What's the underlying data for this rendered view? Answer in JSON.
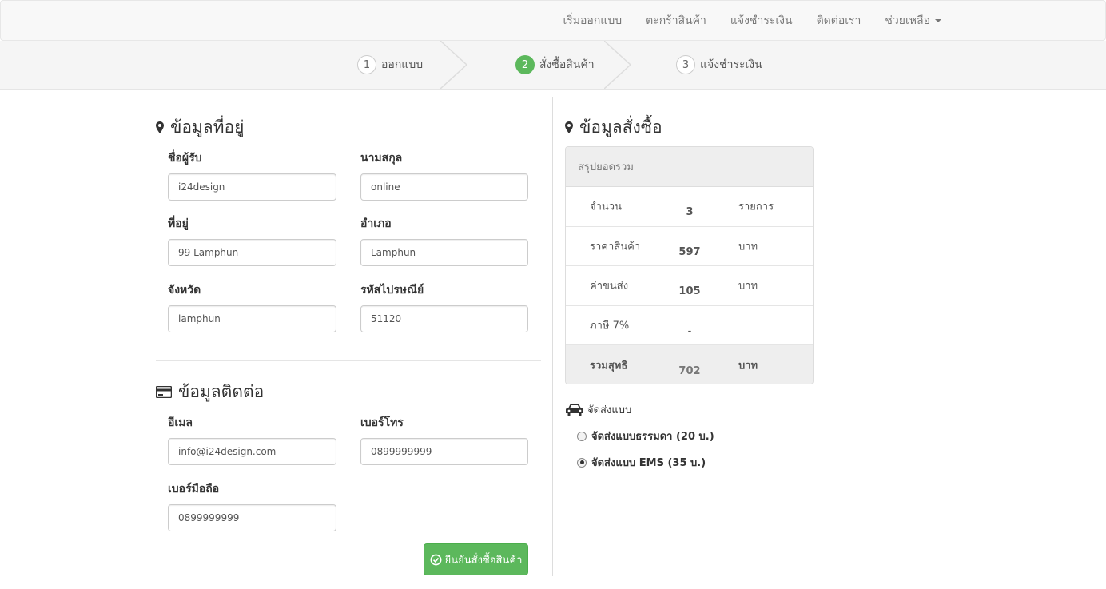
{
  "nav": {
    "items": [
      "เริ่มออกแบบ",
      "ตะกร้าสินค้า",
      "แจ้งชำระเงิน",
      "ติดต่อเรา",
      "ช่วยเหลือ"
    ]
  },
  "steps": [
    {
      "num": "1",
      "label": "ออกแบบ"
    },
    {
      "num": "2",
      "label": "สั่งซื้อสินค้า"
    },
    {
      "num": "3",
      "label": "แจ้งชำระเงิน"
    }
  ],
  "address": {
    "title": "ข้อมูลที่อยู่",
    "first_name_label": "ชื่อผู้รับ",
    "first_name_value": "i24design",
    "last_name_label": "นามสกุล",
    "last_name_value": "online",
    "address_label": "ที่อยู่",
    "address_value": "99 Lamphun",
    "district_label": "อำเภอ",
    "district_value": "Lamphun",
    "province_label": "จังหวัด",
    "province_value": "lamphun",
    "postcode_label": "รหัสไปรษณีย์",
    "postcode_value": "51120"
  },
  "contact": {
    "title": "ข้อมูลติดต่อ",
    "email_label": "อีเมล",
    "email_value": "info@i24design.com",
    "phone_label": "เบอร์โทร",
    "phone_value": "0899999999",
    "mobile_label": "เบอร์มือถือ",
    "mobile_value": "0899999999"
  },
  "confirm_button": "ยืนยันสั่งซื้อสินค้า",
  "order": {
    "title": "ข้อมูลสั่งซื้อ",
    "summary_header": "สรุปยอดรวม",
    "rows": [
      {
        "label": "จำนวน",
        "value": "3",
        "unit": "รายการ"
      },
      {
        "label": "ราคาสินค้า",
        "value": "597",
        "unit": "บาท"
      },
      {
        "label": "ค่าขนส่ง",
        "value": "105",
        "unit": "บาท"
      },
      {
        "label": "ภาษี 7%",
        "value": "-",
        "unit": ""
      },
      {
        "label": "รวมสุทธิ",
        "value": "702",
        "unit": "บาท"
      }
    ]
  },
  "shipping": {
    "title": "จัดส่งแบบ",
    "options": [
      {
        "label": "จัดส่งแบบธรรมดา (20 บ.)",
        "checked": false
      },
      {
        "label": "จัดส่งแบบ EMS (35 บ.)",
        "checked": true
      }
    ]
  },
  "colors": {
    "accent_green": "#5cb85c",
    "navbar_bg": "#f8f8f8",
    "summary_bg": "#eeeeee"
  }
}
